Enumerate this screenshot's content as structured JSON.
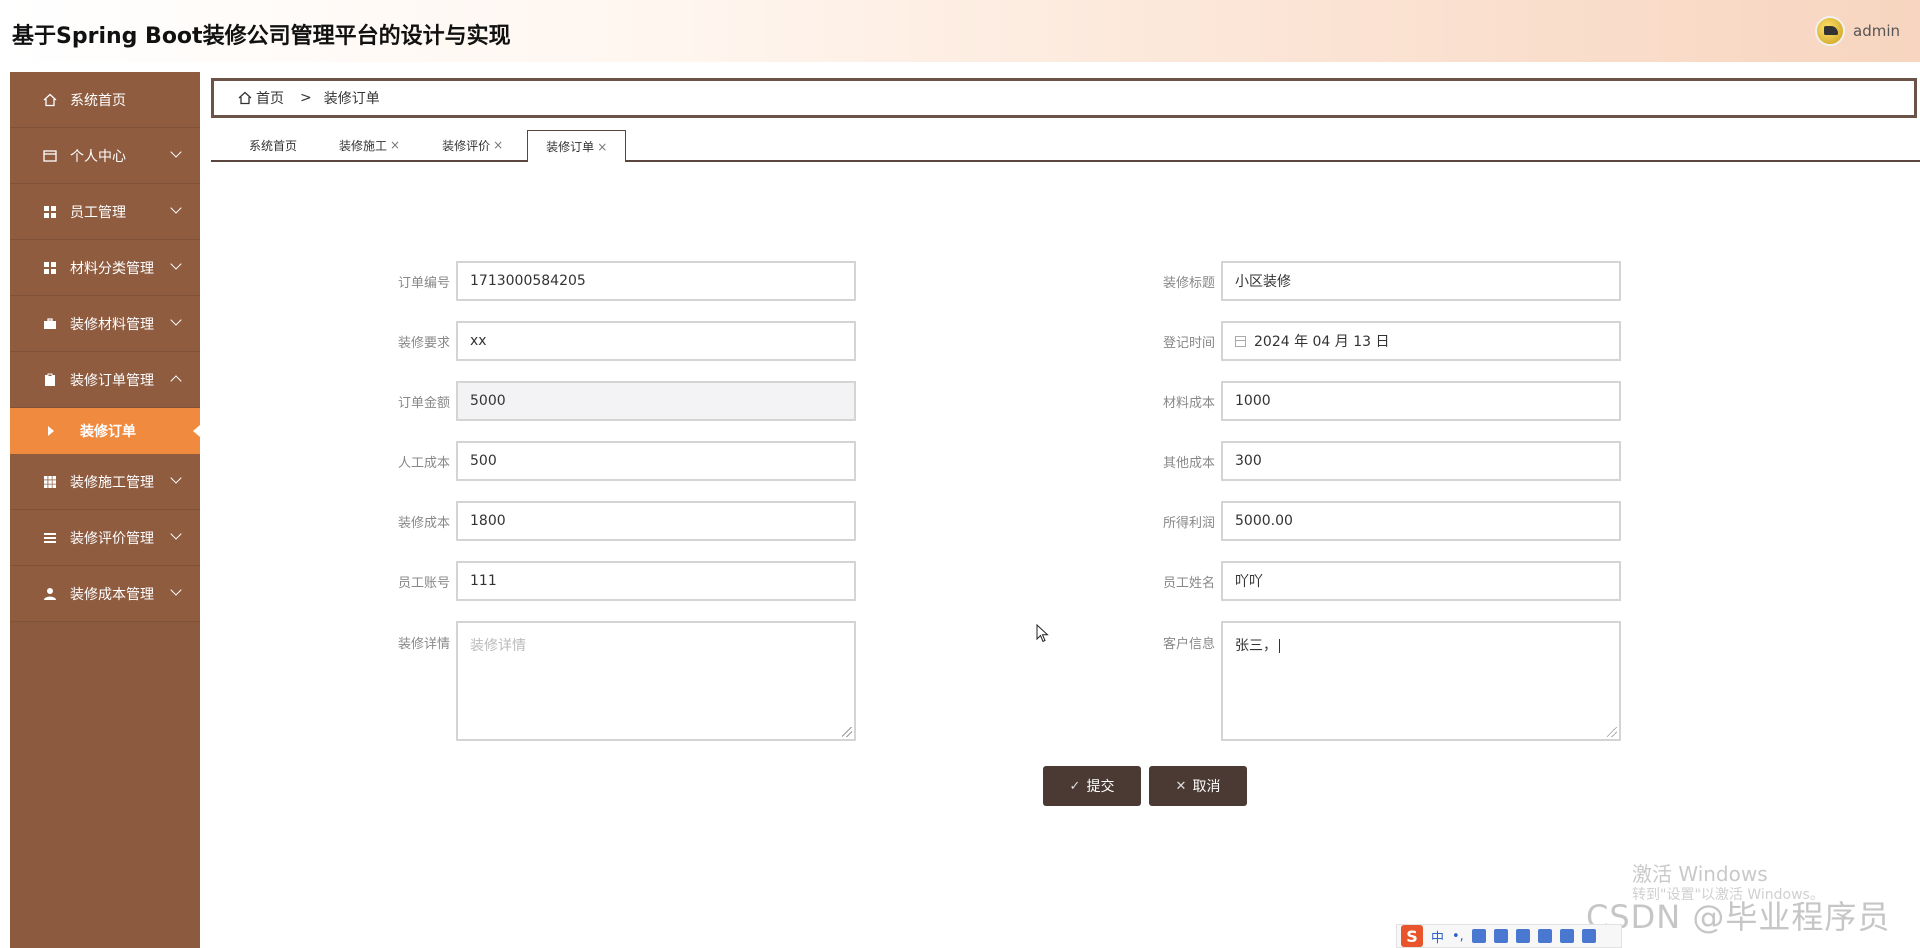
{
  "header": {
    "title": "基于Spring Boot装修公司管理平台的设计与实现",
    "username": "admin"
  },
  "sidebar": {
    "items": [
      {
        "label": "系统首页",
        "icon": "home-icon"
      },
      {
        "label": "个人中心",
        "icon": "window-icon"
      },
      {
        "label": "员工管理",
        "icon": "grid-icon"
      },
      {
        "label": "材料分类管理",
        "icon": "grid-icon"
      },
      {
        "label": "装修材料管理",
        "icon": "briefcase-icon"
      },
      {
        "label": "装修订单管理",
        "icon": "clipboard-icon"
      },
      {
        "label": "装修施工管理",
        "icon": "table-icon"
      },
      {
        "label": "装修评价管理",
        "icon": "list-icon"
      },
      {
        "label": "装修成本管理",
        "icon": "user-icon"
      }
    ],
    "active_sub": "装修订单"
  },
  "breadcrumb": {
    "home": "首页",
    "separator": ">",
    "current": "装修订单"
  },
  "tabs": [
    {
      "label": "系统首页",
      "closable": false
    },
    {
      "label": "装修施工",
      "closable": true
    },
    {
      "label": "装修评价",
      "closable": true
    },
    {
      "label": "装修订单",
      "closable": true,
      "active": true
    }
  ],
  "tab_close": "×",
  "form": {
    "order_no": {
      "label": "订单编号",
      "value": "1713000584205"
    },
    "title": {
      "label": "装修标题",
      "value": "小区装修"
    },
    "requirement": {
      "label": "装修要求",
      "value": "xx"
    },
    "register_time": {
      "label": "登记时间",
      "value": "2024 年 04 月 13 日"
    },
    "order_amount": {
      "label": "订单金额",
      "value": "5000"
    },
    "material_cost": {
      "label": "材料成本",
      "value": "1000"
    },
    "labor_cost": {
      "label": "人工成本",
      "value": "500"
    },
    "other_cost": {
      "label": "其他成本",
      "value": "300"
    },
    "decoration_cost": {
      "label": "装修成本",
      "value": "1800"
    },
    "profit": {
      "label": "所得利润",
      "value": "5000.00"
    },
    "employee_account": {
      "label": "员工账号",
      "value": "111"
    },
    "employee_name": {
      "label": "员工姓名",
      "value": "吖吖"
    },
    "details": {
      "label": "装修详情",
      "placeholder": "装修详情"
    },
    "customer_info": {
      "label": "客户信息",
      "value": "张三，"
    }
  },
  "buttons": {
    "submit": "提交",
    "cancel": "取消"
  },
  "watermark": {
    "activate": "激活 Windows",
    "activate_sub": "转到\"设置\"以激活 Windows。",
    "csdn": "CSDN @毕业程序员"
  },
  "ime": {
    "logo": "S",
    "mode": "中",
    "punct": "•,"
  },
  "colors": {
    "sidebar": "#8c5a3e",
    "sidebar_active": "#f08a3e",
    "button": "#4a3a33"
  }
}
